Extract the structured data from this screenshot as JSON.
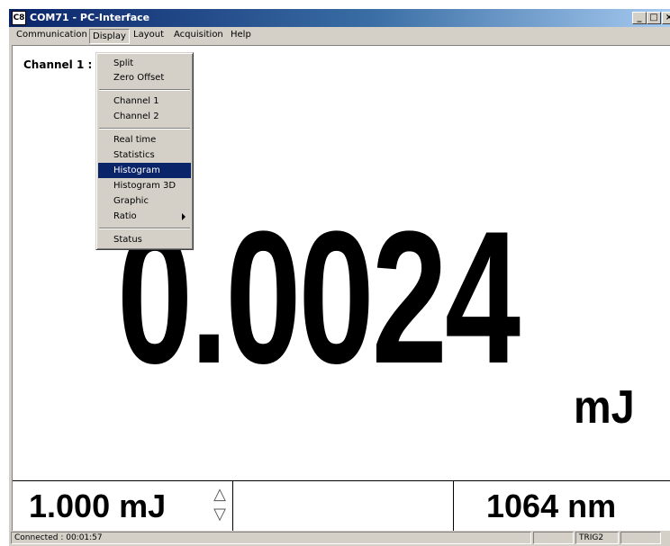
{
  "window": {
    "icon_text": "C8",
    "title": "COM71 - PC-Interface",
    "minimize": "_",
    "maximize": "□",
    "close": "×"
  },
  "menubar": {
    "items": [
      "Communication",
      "Display",
      "Layout",
      "Acquisition",
      "Help"
    ],
    "open_menu": "Display"
  },
  "display_menu": {
    "items": [
      "Split",
      "Zero Offset",
      "Channel 1",
      "Channel 2",
      "Real time",
      "Statistics",
      "Histogram",
      "Histogram 3D",
      "Graphic",
      "Ratio",
      "Status"
    ],
    "highlighted": "Histogram",
    "submenu_item": "Ratio"
  },
  "main": {
    "channel_label": "Channel 1 :",
    "reading": "0.0024",
    "unit": "mJ"
  },
  "bottom": {
    "range": "1.000 mJ",
    "range_up_icon": "triangle-up-outline",
    "range_down_icon": "triangle-down-outline",
    "wavelength": "1064 nm"
  },
  "statusbar": {
    "connection": "Connected : 00:01:57",
    "trigger": "TRIG2"
  },
  "colors": {
    "titlebar_start": "#0a246a",
    "titlebar_end": "#a6caf0",
    "menu_highlight": "#0a246a",
    "chrome": "#d4d0c8"
  }
}
